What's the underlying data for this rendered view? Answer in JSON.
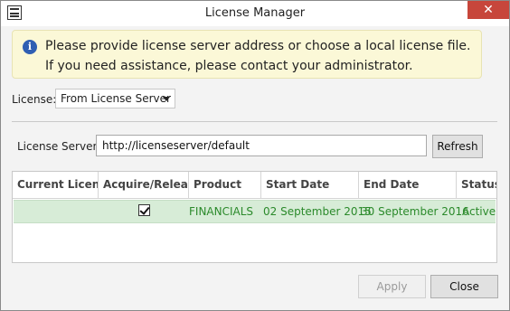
{
  "window": {
    "title": "License Manager",
    "close_glyph": "✕"
  },
  "info": {
    "icon": "info-icon",
    "message": "Please provide license server address or choose a local license file. If you need assistance, please contact your administrator."
  },
  "license": {
    "label": "License:",
    "selected": "From License Server"
  },
  "server": {
    "label": "License Server:",
    "value": "http://licenseserver/default",
    "refresh_label": "Refresh"
  },
  "table": {
    "columns": [
      "Current License",
      "Acquire/Release",
      "Product",
      "Start Date",
      "End Date",
      "Status"
    ],
    "rows": [
      {
        "current": "",
        "acquire_checked": true,
        "product": "FINANCIALS",
        "start_date": "02 September 2015",
        "end_date": "30 September 2016",
        "status": "Active"
      }
    ],
    "row_color": "#2b8a2b"
  },
  "buttons": {
    "apply_label": "Apply",
    "close_label": "Close"
  }
}
